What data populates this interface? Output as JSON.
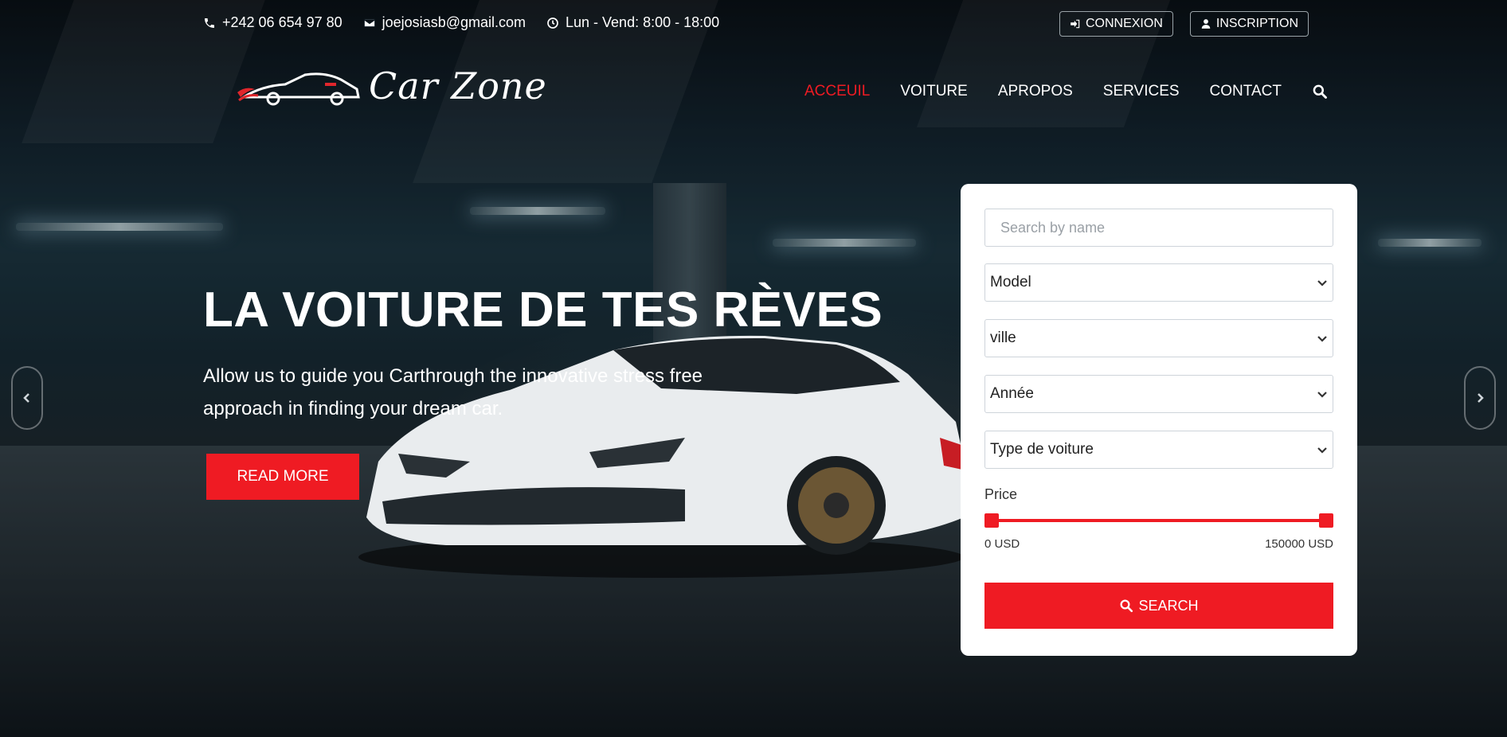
{
  "topbar": {
    "phone": "+242 06 654 97 80",
    "email": "joejosiasb@gmail.com",
    "hours": "Lun - Vend: 8:00 - 18:00"
  },
  "auth": {
    "login_label": "CONNEXION",
    "signup_label": "INSCRIPTION"
  },
  "logo": {
    "text": "Car Zone"
  },
  "nav": {
    "items": [
      "ACCEUIL",
      "VOITURE",
      "APROPOS",
      "SERVICES",
      "CONTACT"
    ],
    "active": "ACCEUIL"
  },
  "hero": {
    "title": "LA VOITURE DE TES RÈVES",
    "subtitle": "Allow us to guide you Carthrough the innovative stress free approach in finding your dream car.",
    "button_label": "READ MORE"
  },
  "search_panel": {
    "name_placeholder": "Search by name",
    "model_value": "Model",
    "city_value": "ville",
    "year_value": "Année",
    "type_value": "Type de voiture",
    "price_label": "Price",
    "price_min": "0 USD",
    "price_max": "150000 USD",
    "button_label": "SEARCH"
  },
  "colors": {
    "accent": "#ef1b23",
    "panel_bg": "#ffffff"
  }
}
